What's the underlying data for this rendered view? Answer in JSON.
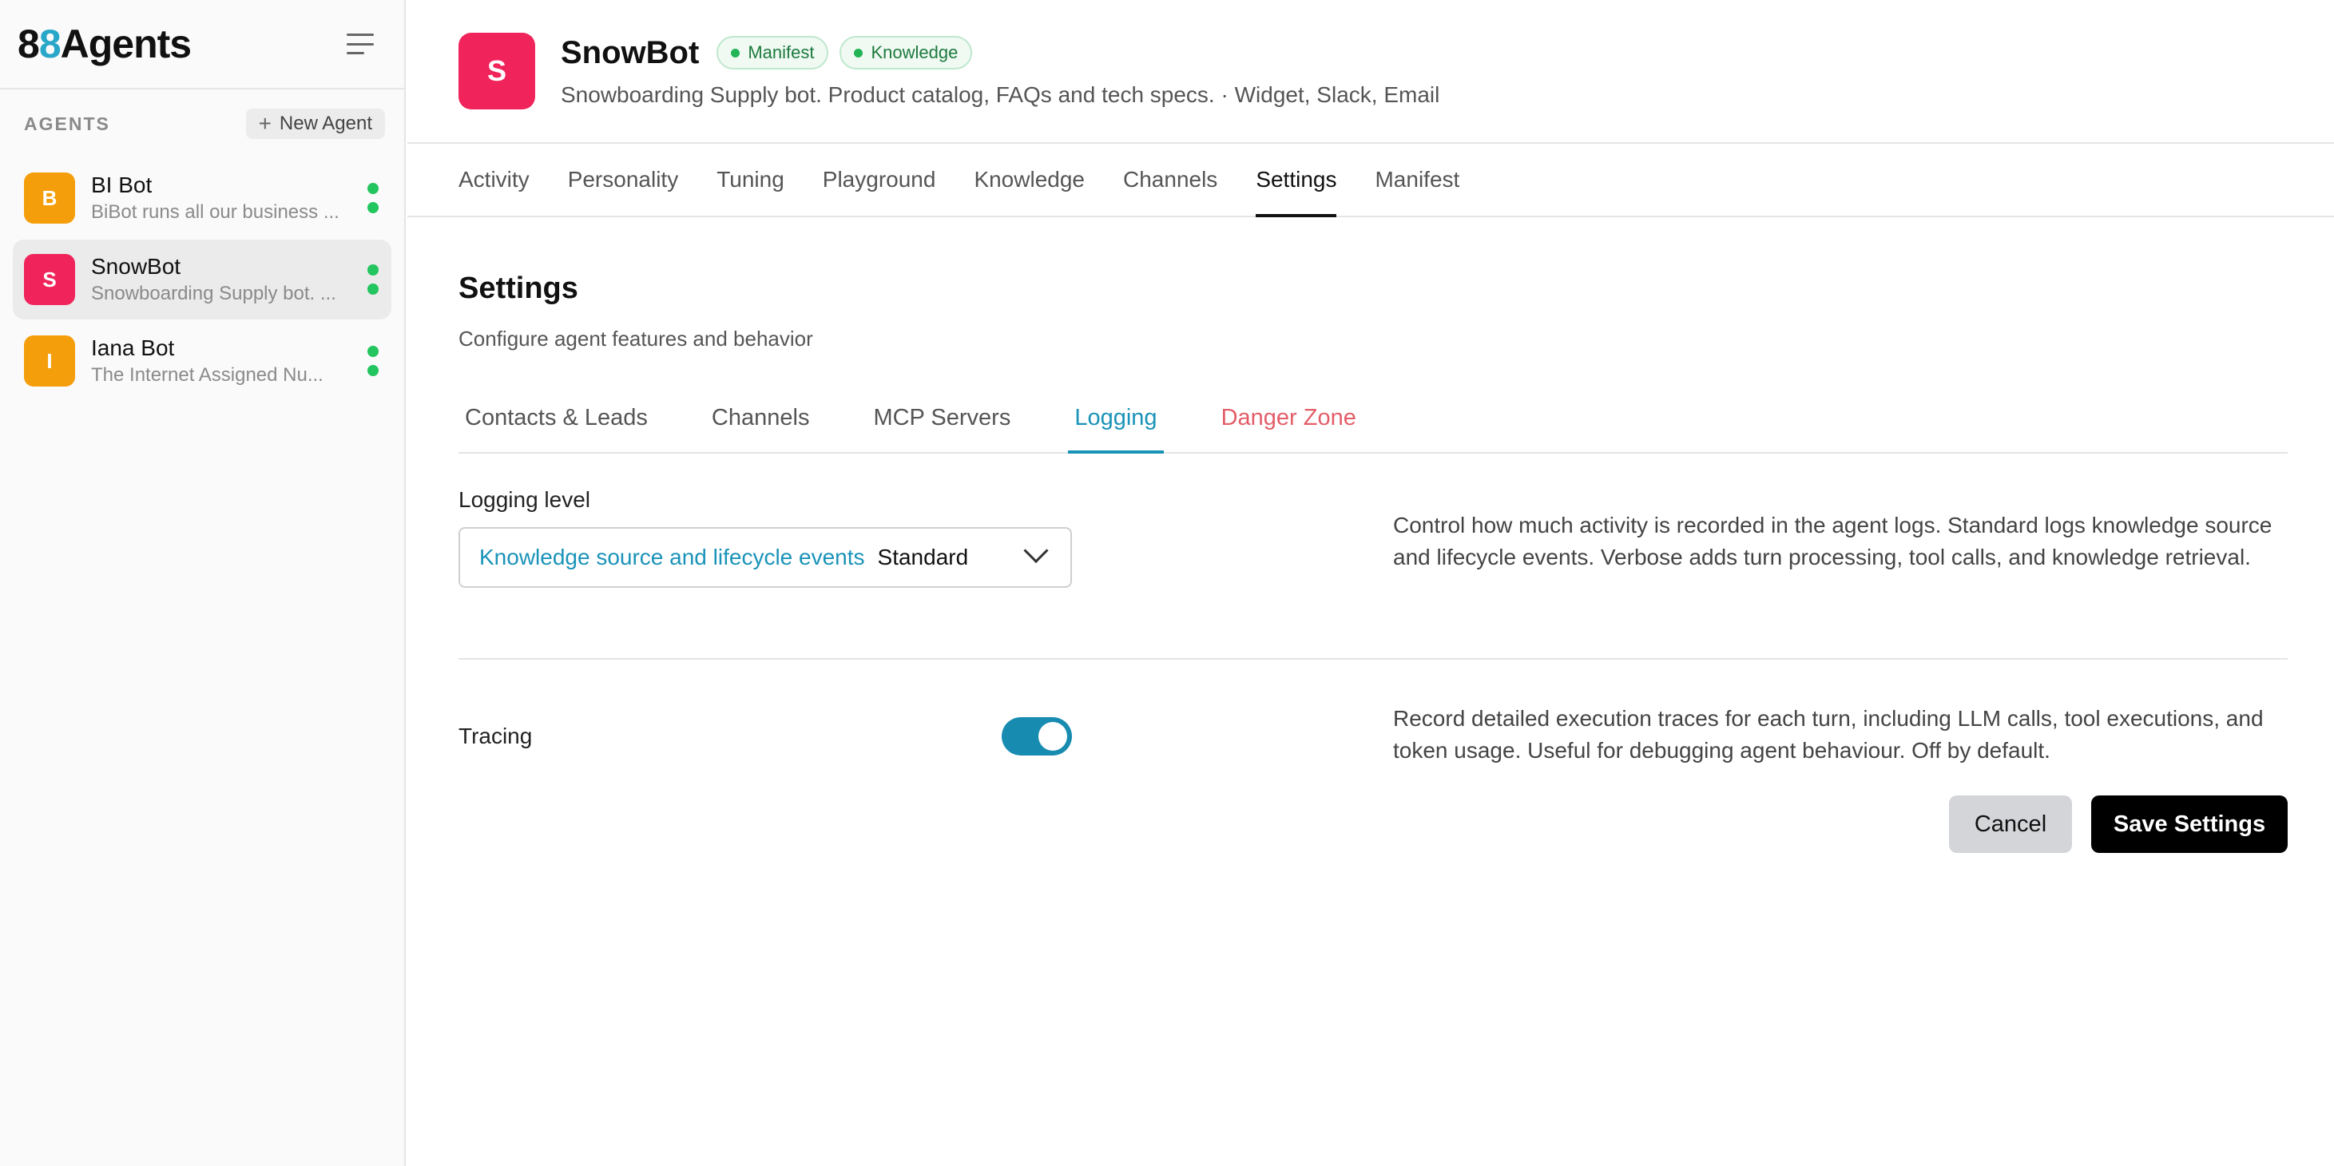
{
  "brand": {
    "logo_a": "8",
    "logo_b": "8",
    "logo_c": "Agents",
    "accent_color": "#29a7c9"
  },
  "sidebar": {
    "section_title": "AGENTS",
    "new_agent_label": "New Agent",
    "agents": [
      {
        "initial": "B",
        "name": "BI Bot",
        "desc": "BiBot runs all our business ...",
        "avatar_color": "#f59e0b",
        "active": false
      },
      {
        "initial": "S",
        "name": "SnowBot",
        "desc": "Snowboarding Supply bot. ...",
        "avatar_color": "#f0245a",
        "active": true
      },
      {
        "initial": "I",
        "name": "Iana Bot",
        "desc": "The Internet Assigned Nu...",
        "avatar_color": "#f59e0b",
        "active": false
      }
    ],
    "status_color": "#22c55e"
  },
  "header": {
    "initial": "S",
    "avatar_color": "#f0245a",
    "title": "SnowBot",
    "badges": [
      "Manifest",
      "Knowledge"
    ],
    "subtitle": "Snowboarding Supply bot. Product catalog, FAQs and tech specs. · Widget, Slack, Email"
  },
  "tabs": [
    "Activity",
    "Personality",
    "Tuning",
    "Playground",
    "Knowledge",
    "Channels",
    "Settings",
    "Manifest"
  ],
  "active_tab": "Settings",
  "settings": {
    "title": "Settings",
    "subtitle": "Configure agent features and behavior",
    "subtabs": [
      "Contacts & Leads",
      "Channels",
      "MCP Servers",
      "Logging",
      "Danger Zone"
    ],
    "active_subtab": "Logging",
    "logging": {
      "label": "Logging level",
      "selected_desc": "Knowledge source and lifecycle events",
      "selected_value": "Standard",
      "help": "Control how much activity is recorded in the agent logs. Standard logs knowledge source and lifecycle events. Verbose adds turn processing, tool calls, and knowledge retrieval."
    },
    "tracing": {
      "label": "Tracing",
      "enabled": true,
      "help": "Record detailed execution traces for each turn, including LLM calls, tool executions, and token usage. Useful for debugging agent behaviour. Off by default."
    },
    "cancel_label": "Cancel",
    "save_label": "Save Settings"
  }
}
